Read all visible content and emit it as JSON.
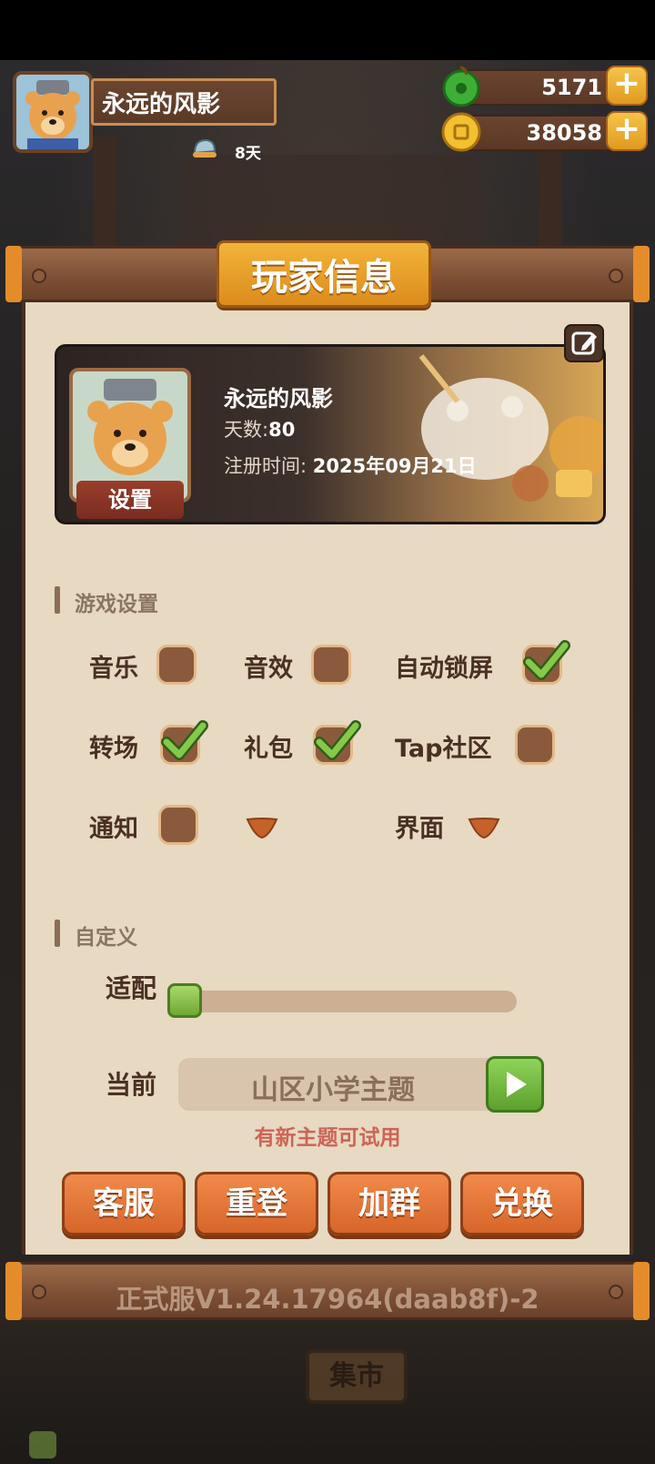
{
  "hud": {
    "player_name": "永远的风影",
    "days_badge": "8天",
    "jade_amount": "5171",
    "coin_amount": "38058",
    "plus_symbol": "+"
  },
  "panel": {
    "title": "玩家信息"
  },
  "profile": {
    "name": "永远的风影",
    "days_label": "天数:",
    "days_value": "80",
    "register_label": "注册时间:",
    "register_value": "2025年09月21日",
    "settings_label": "设置"
  },
  "game_settings": {
    "title": "游戏设置",
    "options": [
      {
        "label": "音乐",
        "checked": false
      },
      {
        "label": "音效",
        "checked": false
      },
      {
        "label": "自动锁屏",
        "checked": true
      },
      {
        "label": "转场",
        "checked": true
      },
      {
        "label": "礼包",
        "checked": true
      },
      {
        "label": "Tap社区",
        "checked": false
      },
      {
        "label": "通知",
        "checked": false
      },
      {
        "label": "界面"
      }
    ]
  },
  "custom": {
    "title": "自定义",
    "adapt_label": "适配",
    "adapt_level": 0,
    "current_label": "当前",
    "current_theme": "山区小学主题",
    "new_theme_hint": "有新主题可试用"
  },
  "actions": {
    "customer_service": "客服",
    "relogin": "重登",
    "join_group": "加群",
    "redeem": "兑换"
  },
  "version": "正式服V1.24.17964(daab8f)-2",
  "background": {
    "market_sign": "集市"
  },
  "colors": {
    "panel_bg": "#e7d9c2",
    "accent_orange": "#e0752f",
    "check_green": "#6fae33",
    "hint_red": "#cd6456"
  }
}
